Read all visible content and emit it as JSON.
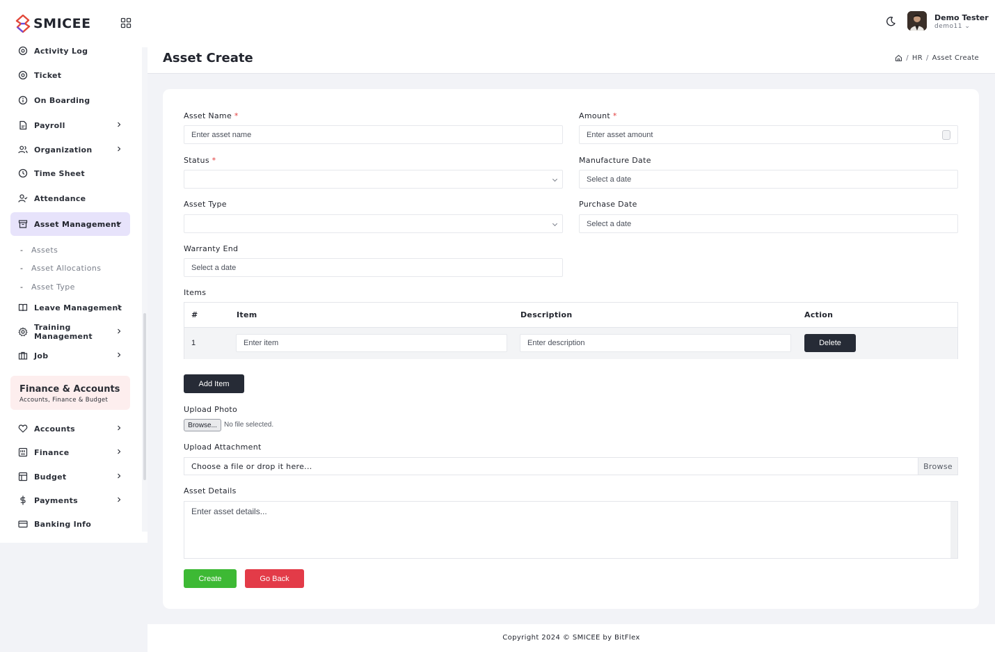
{
  "brand": {
    "name": "SMICEE"
  },
  "sidebar": {
    "items": [
      {
        "label": "Activity Log",
        "icon": "activity-icon"
      },
      {
        "label": "Ticket",
        "icon": "ticket-icon"
      },
      {
        "label": "On Boarding",
        "icon": "info-icon"
      },
      {
        "label": "Payroll",
        "icon": "document-icon"
      },
      {
        "label": "Organization",
        "icon": "users-icon"
      },
      {
        "label": "Time Sheet",
        "icon": "clock-icon"
      },
      {
        "label": "Attendance",
        "icon": "user-check-icon"
      },
      {
        "label": "Asset Management",
        "icon": "archive-icon"
      },
      {
        "label": "Leave Management",
        "icon": "book-icon"
      },
      {
        "label": "Training Management",
        "icon": "gear-icon"
      },
      {
        "label": "Job",
        "icon": "briefcase-icon"
      }
    ],
    "sub_items": [
      "Assets",
      "Asset Allocations",
      "Asset Type"
    ],
    "section": {
      "title": "Finance & Accounts",
      "subtitle": "Accounts, Finance & Budget"
    },
    "finance_items": [
      {
        "label": "Accounts",
        "icon": "heart-icon"
      },
      {
        "label": "Finance",
        "icon": "finance-icon"
      },
      {
        "label": "Budget",
        "icon": "layout-icon"
      },
      {
        "label": "Payments",
        "icon": "dollar-icon"
      },
      {
        "label": "Banking Info",
        "icon": "card-icon"
      }
    ]
  },
  "user": {
    "name": "Demo Tester",
    "id": "demo11"
  },
  "page": {
    "title": "Asset Create",
    "breadcrumb": [
      "HR",
      "Asset Create"
    ]
  },
  "form": {
    "asset_name": {
      "label": "Asset Name",
      "placeholder": "Enter asset name"
    },
    "amount": {
      "label": "Amount",
      "placeholder": "Enter asset amount"
    },
    "status": {
      "label": "Status"
    },
    "manufacture_date": {
      "label": "Manufacture Date",
      "placeholder": "Select a date"
    },
    "asset_type": {
      "label": "Asset Type"
    },
    "purchase_date": {
      "label": "Purchase Date",
      "placeholder": "Select a date"
    },
    "warranty_end": {
      "label": "Warranty End",
      "placeholder": "Select a date"
    },
    "required_mark": "*",
    "items": {
      "label": "Items",
      "headers": [
        "#",
        "Item",
        "Description",
        "Action"
      ],
      "rows": [
        {
          "index": "1",
          "item_placeholder": "Enter item",
          "desc_placeholder": "Enter description",
          "action": "Delete"
        }
      ],
      "add_label": "Add Item"
    },
    "upload_photo": {
      "label": "Upload Photo",
      "button": "Browse...",
      "status": "No file selected."
    },
    "upload_attachment": {
      "label": "Upload Attachment",
      "placeholder": "Choose a file or drop it here...",
      "button": "Browse"
    },
    "asset_details": {
      "label": "Asset Details",
      "placeholder": "Enter asset details..."
    },
    "create_label": "Create",
    "back_label": "Go Back"
  },
  "footer": {
    "text": "Copyright 2024 © SMICEE by BitFlex"
  },
  "colors": {
    "accent": "#e7e3fb",
    "dark_button": "#262b36",
    "create": "#3db934",
    "back": "#e33b48",
    "required": "#e23b3b"
  }
}
